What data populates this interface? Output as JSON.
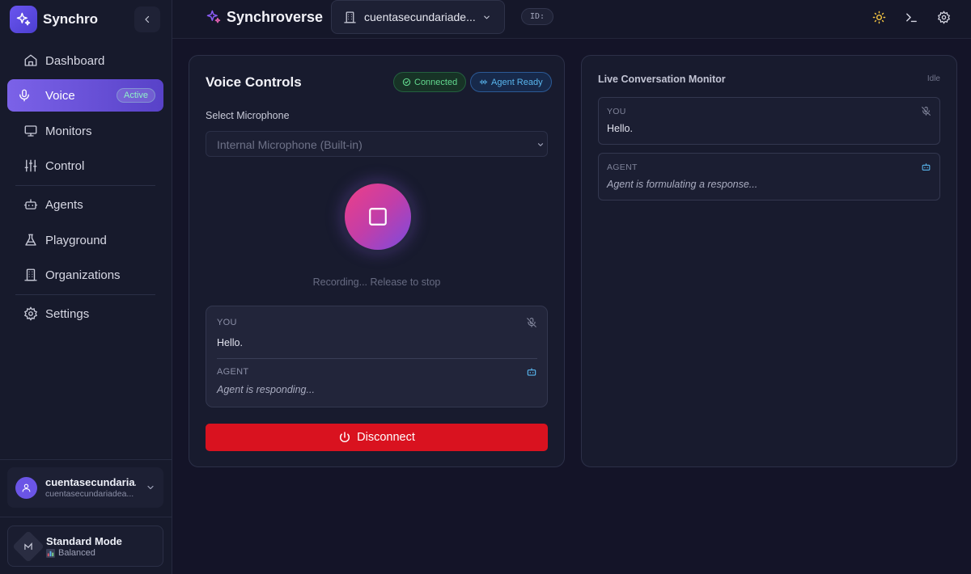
{
  "sidebar": {
    "brand": "Synchro",
    "nav": [
      {
        "label": "Dashboard",
        "icon": "home-icon"
      },
      {
        "label": "Voice",
        "icon": "microphone-icon",
        "badge": "Active",
        "active": true
      },
      {
        "label": "Monitors",
        "icon": "monitor-icon"
      },
      {
        "label": "Control",
        "icon": "sliders-icon"
      },
      {
        "label": "Agents",
        "icon": "bot-icon"
      },
      {
        "label": "Playground",
        "icon": "flask-icon"
      },
      {
        "label": "Organizations",
        "icon": "building-icon"
      },
      {
        "label": "Settings",
        "icon": "gear-icon"
      }
    ],
    "user": {
      "name": "cuentasecundaria...",
      "email": "cuentasecundariadea..."
    },
    "mode": {
      "title": "Standard Mode",
      "subtitle": "Balanced"
    }
  },
  "topbar": {
    "title": "Synchroverse",
    "org": "cuentasecundariade...",
    "id_label": "ID:"
  },
  "voice": {
    "title": "Voice Controls",
    "status_connected": "Connected",
    "status_agent": "Agent Ready",
    "mic_label": "Select Microphone",
    "mic_value": "Internal Microphone (Built-in)",
    "recording_status": "Recording... Release to stop",
    "transcript": {
      "you_label": "YOU",
      "you_text": "Hello.",
      "agent_label": "AGENT",
      "agent_text": "Agent is responding..."
    },
    "disconnect_label": "Disconnect"
  },
  "monitor": {
    "title": "Live Conversation Monitor",
    "status": "Idle",
    "messages": [
      {
        "role": "YOU",
        "text": "Hello."
      },
      {
        "role": "AGENT",
        "text": "Agent is formulating a response..."
      }
    ]
  },
  "colors": {
    "accent": "#6a55ef",
    "danger": "#d9121f",
    "success": "#63d98f",
    "info": "#59b6ee"
  }
}
